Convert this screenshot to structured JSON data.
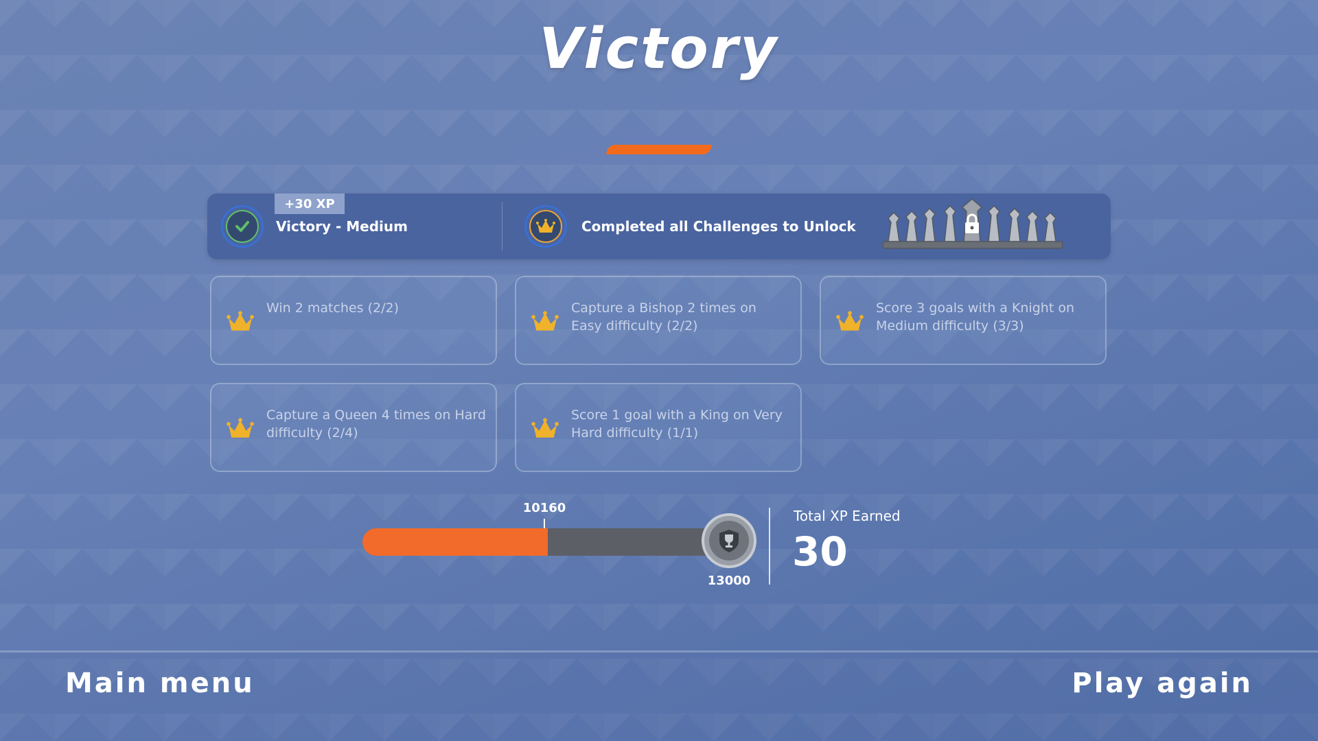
{
  "screen": {
    "title": "Victory"
  },
  "banner": {
    "xp_badge": "+30 XP",
    "result_label": "Victory - Medium",
    "unlock_label": "Completed all Challenges to Unlock"
  },
  "challenges": [
    {
      "text": "Win 2 matches (2/2)"
    },
    {
      "text": "Capture a Bishop 2 times on Easy difficulty  (2/2)"
    },
    {
      "text": "Score 3 goals with a Knight on Medium difficulty  (3/3)"
    },
    {
      "text": "Capture a Queen 4 times on Hard difficulty  (2/4)"
    },
    {
      "text": "Score 1 goal with a King on Very Hard difficulty  (1/1)"
    }
  ],
  "progress": {
    "current_xp": "10160",
    "target_xp": "13000",
    "fill_fraction": 0.53
  },
  "total_xp": {
    "label": "Total XP Earned",
    "value": "30"
  },
  "footer": {
    "main_menu": "Main menu",
    "play_again": "Play again"
  },
  "colors": {
    "accent": "#f26b2a",
    "crown": "#f0b22a",
    "check": "#5fbf6a"
  },
  "icons": [
    "check-icon",
    "crown-icon",
    "lock-icon",
    "trophy-icon",
    "chess-pieces-icon"
  ]
}
